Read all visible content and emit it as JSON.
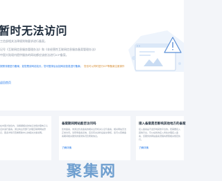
{
  "page": {
    "title": "暂时无法访问",
    "line1": "工信部相关法律规则和要求进行备案。",
    "line2": "记号《互联网信息服务管理办法》和《非经营性互联网信息服务备案管理办法》",
    "line3": "中国大陆境内提供服务的网站都应该依法进行ICP备案。",
    "notice_link": "按照流程进行备案，如您是该网站站长，您可登录后台如网站信息进行备案。",
    "notice_extra": "您也可以同时进行ICP等备案注册操作",
    "back_link": "返回首页"
  },
  "cards": [
    {
      "title": "",
      "text": "在中国大陆境内，请根据相关的信息法规办理电子认证并进行备案。通过向主管部门办理互联网网站登记，更多详情可查看帮助中心的相关文章说明。",
      "link": ""
    },
    {
      "title": "备案期间网站能否访问吗",
      "text": "您未备案，未通过负责备案的相关主管机关认证与备案，相关网站无法正常访问。请登录备案系统，完善有关资料后提交审核，您可以查看备案期间相关服务的使用情况及帮助信息。",
      "link": "了解详情"
    },
    {
      "title": "接入备案是否影响其他地方的备案",
      "text": "接入备案是不会影响其他平台的。若需要接入其他平台，可以在新的接入商处办理接入备案，该服务的网站备案流程将按照相关规定执行。",
      "link": "了解详情"
    }
  ],
  "watermark": "聚集网",
  "colors": {
    "accent": "#1a73e8",
    "warning": "#d48a2e",
    "title": "#1f2d3d",
    "muted": "#8a94a3",
    "background": "#f3f5f9"
  }
}
